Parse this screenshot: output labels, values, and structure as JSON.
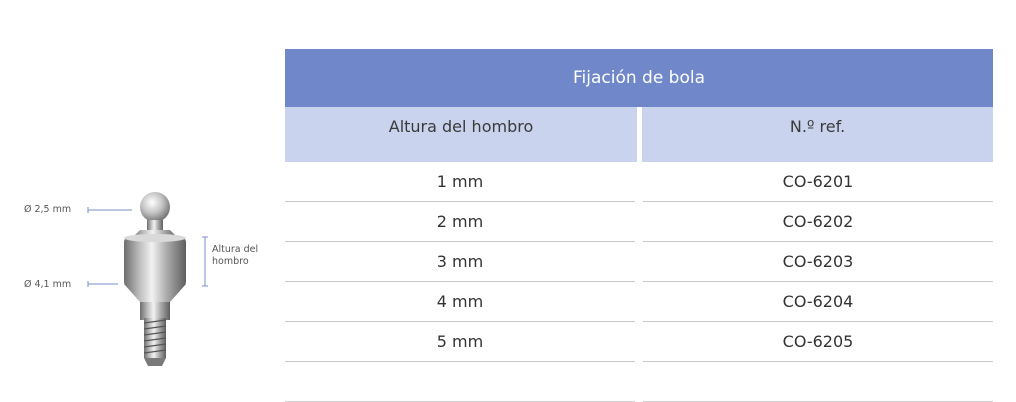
{
  "figure": {
    "diameter_top": "Ø 2,5 mm",
    "diameter_bottom": "Ø 4,1 mm",
    "height_label": "Altura del hombro"
  },
  "table": {
    "title": "Fijación de bola",
    "columns": [
      "Altura del hombro",
      "N.º ref."
    ],
    "rows": [
      [
        "1 mm",
        "CO-6201"
      ],
      [
        "2 mm",
        "CO-6202"
      ],
      [
        "3 mm",
        "CO-6203"
      ],
      [
        "4 mm",
        "CO-6204"
      ],
      [
        "5 mm",
        "CO-6205"
      ],
      [
        "",
        ""
      ]
    ]
  },
  "colors": {
    "title_bg": "#7087c9",
    "header_bg": "#c9d3ee",
    "dimension_line": "#7a8fd0"
  }
}
